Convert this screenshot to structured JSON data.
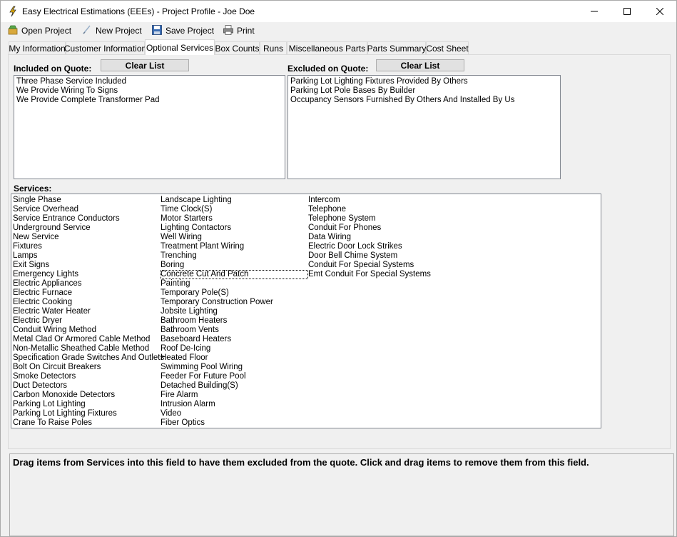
{
  "window": {
    "title": "Easy Electrical Estimations (EEEs) - Project Profile - Joe Doe",
    "minimize": "—",
    "maximize": "☐",
    "close": "✕"
  },
  "toolbar": {
    "open_label": "Open Project",
    "new_label": "New Project",
    "save_label": "Save Project",
    "print_label": "Print"
  },
  "tabs": [
    {
      "label": "My Information"
    },
    {
      "label": "Customer Information"
    },
    {
      "label": "Optional Services",
      "active": true
    },
    {
      "label": "Box Counts"
    },
    {
      "label": "Runs"
    },
    {
      "label": "Miscellaneous Parts"
    },
    {
      "label": "Parts Summary"
    },
    {
      "label": "Cost Sheet"
    }
  ],
  "included": {
    "label": "Included on Quote:",
    "clear_label": "Clear List",
    "items": [
      "Three Phase Service Included",
      "We Provide Wiring To Signs",
      "We Provide Complete Transformer Pad"
    ]
  },
  "excluded": {
    "label": "Excluded on Quote:",
    "clear_label": "Clear List",
    "items": [
      "Parking Lot Lighting Fixtures Provided By Others",
      "Parking Lot Pole Bases By Builder",
      "Occupancy Sensors Furnished By Others And Installed By Us"
    ]
  },
  "services": {
    "label": "Services:",
    "columns": [
      [
        "Single Phase",
        "Service Overhead",
        "Service Entrance Conductors",
        "Underground Service",
        "New Service",
        "Fixtures",
        "Lamps",
        "Exit Signs",
        "Emergency Lights",
        "Electric Appliances",
        "Electric Furnace",
        "Electric Cooking",
        "Electric Water Heater",
        "Electric Dryer",
        "Conduit Wiring Method",
        "Metal Clad Or Armored Cable Method",
        "Non-Metallic Sheathed Cable Method",
        "Specification Grade Switches And Outlets",
        "Bolt On Circuit Breakers",
        "Smoke Detectors",
        "Duct Detectors",
        "Carbon Monoxide Detectors",
        "Parking Lot Lighting",
        "Parking Lot Lighting Fixtures",
        "Crane To Raise Poles"
      ],
      [
        "Landscape Lighting",
        "Time Clock(S)",
        "Motor Starters",
        "Lighting Contactors",
        "Well Wiring",
        "Treatment Plant Wiring",
        "Trenching",
        "Boring",
        "Concrete Cut And Patch",
        "Painting",
        "Temporary Pole(S)",
        "Temporary Construction Power",
        "Jobsite Lighting",
        "Bathroom Heaters",
        "Bathroom Vents",
        "Baseboard Heaters",
        "Roof De-Icing",
        "Heated Floor",
        "Swimming Pool Wiring",
        "Feeder For Future Pool",
        "Detached Building(S)",
        "Fire Alarm",
        "Intrusion Alarm",
        "Video",
        "Fiber Optics"
      ],
      [
        "Intercom",
        "Telephone",
        "Telephone System",
        "Conduit For Phones",
        "Data Wiring",
        "Electric Door Lock Strikes",
        "Door Bell Chime System",
        "Conduit For Special Systems",
        "Emt Conduit For Special Systems"
      ]
    ],
    "focused_item": "Concrete Cut And Patch"
  },
  "help_text": "Drag items from Services into this field to have them excluded from the quote.  Click and drag items to remove them from this field."
}
